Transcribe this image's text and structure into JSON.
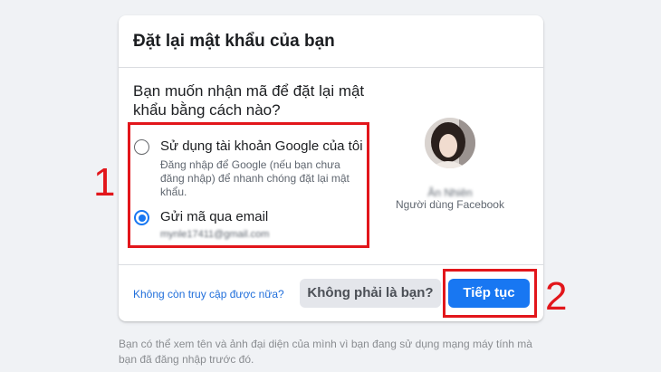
{
  "card": {
    "title": "Đặt lại mật khẩu của bạn",
    "question": "Bạn muốn nhận mã để đặt lại mật khẩu bằng cách nào?",
    "options": [
      {
        "label": "Sử dụng tài khoản Google của tôi",
        "description": "Đăng nhập để Google (nếu bạn chưa đăng nhập) để nhanh chóng đặt lại mật khẩu.",
        "checked": false
      },
      {
        "label": "Gửi mã qua email",
        "email": "mynle17411@gmail.com",
        "checked": true
      }
    ],
    "user": {
      "name": "Ân Nhiên",
      "type": "Người dùng Facebook"
    },
    "footer": {
      "link": "Không còn truy cập được nữa?",
      "not_you_button": "Không phải là bạn?",
      "continue_button": "Tiếp tục"
    }
  },
  "note": "Bạn có thể xem tên và ảnh đại diện của mình vì bạn đang sử dụng mạng máy tính mà bạn đã đăng nhập trước đó.",
  "annotations": [
    "1",
    "2"
  ],
  "colors": {
    "accent": "#1877f2",
    "annotation": "#e2161b",
    "background": "#f0f2f5"
  }
}
